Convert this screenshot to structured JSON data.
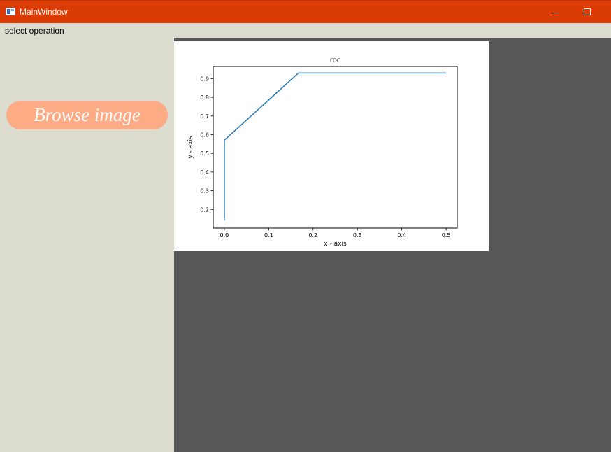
{
  "window": {
    "title": "MainWindow",
    "icon": "app-window-icon",
    "minimize_icon": "minimize-icon",
    "maximize_icon": "maximize-icon"
  },
  "menubar": {
    "label": "select operation"
  },
  "left_panel": {
    "browse_label": "Browse image"
  },
  "colors": {
    "titlebar": "#db3b05",
    "panel": "#dcdccf",
    "dark_area": "#575757",
    "button": "#fdab84",
    "line": "#1f77b4"
  },
  "chart_data": {
    "type": "line",
    "title": "roc",
    "xlabel": "x - axis",
    "ylabel": "y - axis",
    "xlim": [
      -0.025,
      0.525
    ],
    "ylim": [
      0.1,
      0.965
    ],
    "xticks": [
      0.0,
      0.1,
      0.2,
      0.3,
      0.4,
      0.5
    ],
    "xtick_labels": [
      "0.0",
      "0.1",
      "0.2",
      "0.3",
      "0.4",
      "0.5"
    ],
    "yticks": [
      0.2,
      0.3,
      0.4,
      0.5,
      0.6,
      0.7,
      0.8,
      0.9
    ],
    "ytick_labels": [
      "0.2",
      "0.3",
      "0.4",
      "0.5",
      "0.6",
      "0.7",
      "0.8",
      "0.9"
    ],
    "grid": false,
    "series": [
      {
        "x": [
          0.0,
          0.0,
          0.167,
          0.5
        ],
        "y": [
          0.14,
          0.57,
          0.93,
          0.93
        ]
      }
    ]
  }
}
